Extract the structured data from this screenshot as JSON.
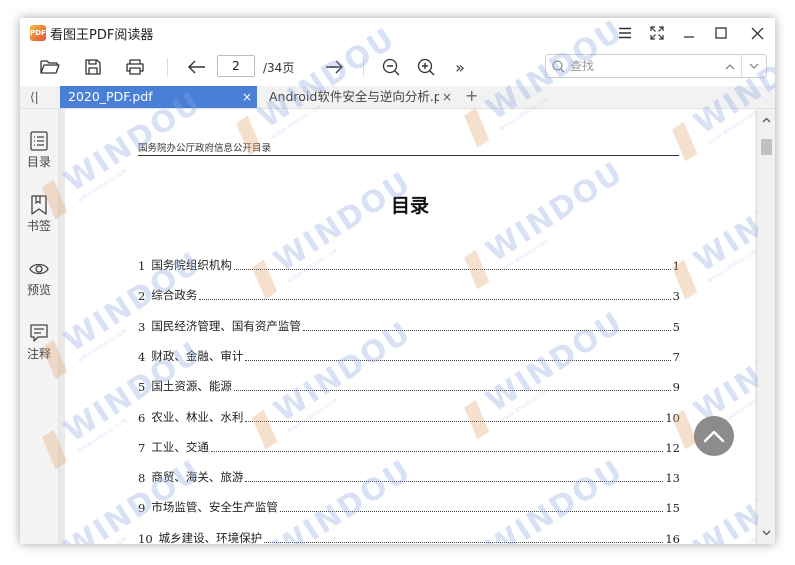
{
  "window": {
    "title": "看图王PDF阅读器",
    "logo_text": "PDF"
  },
  "toolbar": {
    "page_current": "2",
    "page_total": "/34页",
    "more_glyph": "»",
    "search_placeholder": "查找"
  },
  "tabs": [
    {
      "label": "2020_PDF.pdf",
      "active": true
    },
    {
      "label": "Android软件安全与逆向分析.pdf",
      "active": false
    }
  ],
  "tabbar": {
    "back_glyph": "⟨|",
    "add_glyph": "+",
    "close_glyph": "×"
  },
  "sidebar": {
    "items": [
      {
        "label": "目录",
        "icon": "list-icon"
      },
      {
        "label": "书签",
        "icon": "bookmark-icon"
      },
      {
        "label": "预览",
        "icon": "eye-icon"
      },
      {
        "label": "注释",
        "icon": "comment-icon"
      }
    ]
  },
  "document": {
    "running_head": "国务院办公厅政府信息公开目录",
    "toc_title": "目录",
    "toc": [
      {
        "num": "1",
        "text": "国务院组织机构",
        "page": "1"
      },
      {
        "num": "2",
        "text": "综合政务",
        "page": "3"
      },
      {
        "num": "3",
        "text": "国民经济管理、国有资产监管",
        "page": "5"
      },
      {
        "num": "4",
        "text": "财政、金融、审计",
        "page": "7"
      },
      {
        "num": "5",
        "text": "国土资源、能源",
        "page": "9"
      },
      {
        "num": "6",
        "text": "农业、林业、水利",
        "page": "10"
      },
      {
        "num": "7",
        "text": "工业、交通",
        "page": "12"
      },
      {
        "num": "8",
        "text": "商贸、海关、旅游",
        "page": "13"
      },
      {
        "num": "9",
        "text": "市场监管、安全生产监管",
        "page": "15"
      },
      {
        "num": "10",
        "text": "城乡建设、环境保护",
        "page": "16"
      }
    ]
  },
  "watermark": {
    "text": "WINDOU",
    "subtext": "WWW.WINDOU.COM"
  },
  "colors": {
    "active_tab": "#4a7fd8",
    "watermark_blue": "#8aa6e0",
    "watermark_orange": "#e2a06a"
  }
}
